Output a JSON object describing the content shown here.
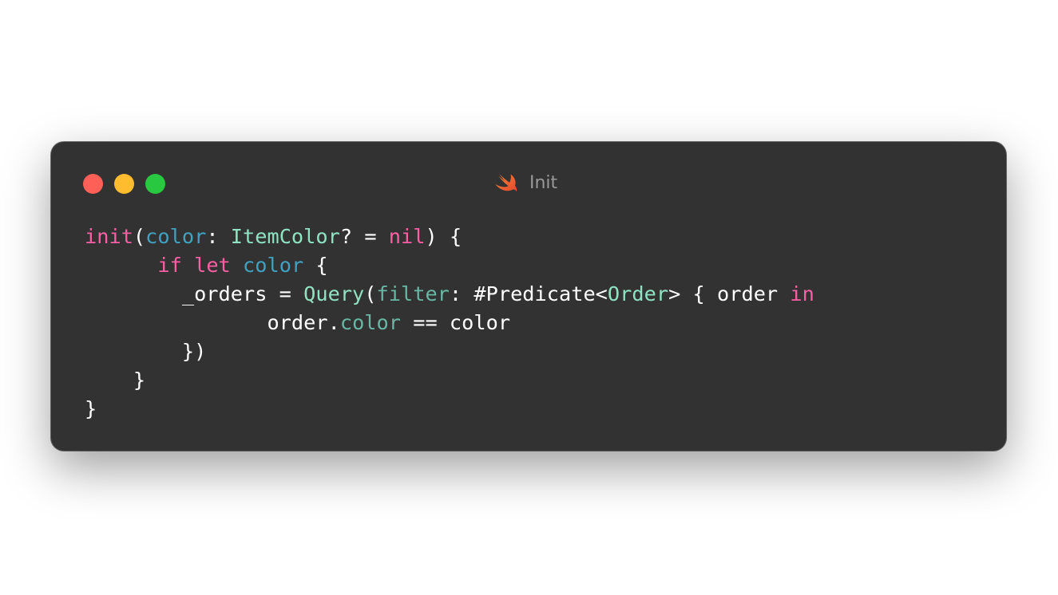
{
  "window": {
    "title": "Init",
    "title_icon": "swift-logo-icon",
    "traffic_lights": {
      "close_color": "#fe5f57",
      "minimize_color": "#febc2e",
      "zoom_color": "#28c840"
    },
    "background_color": "#323232"
  },
  "theme": {
    "keyword_color": "#fc5fa3",
    "parameter_color": "#41a1c0",
    "type_color": "#8fe3c3",
    "property_color": "#67b7a4",
    "text_color": "#ffffff"
  },
  "code": {
    "lines": [
      [
        {
          "t": "init",
          "k": "kw"
        },
        {
          "t": "(",
          "k": "plain"
        },
        {
          "t": "color",
          "k": "param"
        },
        {
          "t": ": ",
          "k": "plain"
        },
        {
          "t": "ItemColor",
          "k": "type"
        },
        {
          "t": "? = ",
          "k": "plain"
        },
        {
          "t": "nil",
          "k": "kw"
        },
        {
          "t": ") {",
          "k": "plain"
        }
      ],
      [
        {
          "t": "      ",
          "k": "plain"
        },
        {
          "t": "if",
          "k": "kw"
        },
        {
          "t": " ",
          "k": "plain"
        },
        {
          "t": "let",
          "k": "kw"
        },
        {
          "t": " ",
          "k": "plain"
        },
        {
          "t": "color",
          "k": "param"
        },
        {
          "t": " {",
          "k": "plain"
        }
      ],
      [
        {
          "t": "        _orders = ",
          "k": "plain"
        },
        {
          "t": "Query",
          "k": "type"
        },
        {
          "t": "(",
          "k": "plain"
        },
        {
          "t": "filter",
          "k": "prop"
        },
        {
          "t": ": #Predicate<",
          "k": "plain"
        },
        {
          "t": "Order",
          "k": "type"
        },
        {
          "t": "> { order ",
          "k": "plain"
        },
        {
          "t": "in",
          "k": "kw"
        }
      ],
      [
        {
          "t": "               order.",
          "k": "plain"
        },
        {
          "t": "color",
          "k": "prop"
        },
        {
          "t": " == color",
          "k": "plain"
        }
      ],
      [
        {
          "t": "        })",
          "k": "plain"
        }
      ],
      [
        {
          "t": "    }",
          "k": "plain"
        }
      ],
      [
        {
          "t": "}",
          "k": "plain"
        }
      ]
    ]
  }
}
